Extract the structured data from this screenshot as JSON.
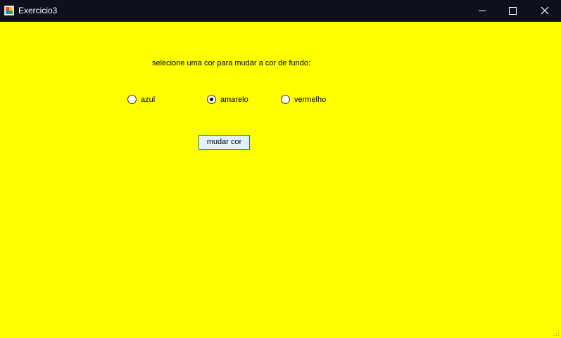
{
  "window": {
    "title": "Exercicio3",
    "background_color": "#ffff00",
    "titlebar_color": "#0f101d",
    "controls": [
      "minimize-icon",
      "maximize-icon",
      "close-icon"
    ]
  },
  "form": {
    "prompt": "selecione uma cor para mudar a cor de fundo:",
    "options": [
      {
        "label": "azul",
        "checked": false
      },
      {
        "label": "amarelo",
        "checked": true
      },
      {
        "label": "vermelho",
        "checked": false
      }
    ],
    "selected": "amarelo",
    "button_label": "mudar cor"
  }
}
